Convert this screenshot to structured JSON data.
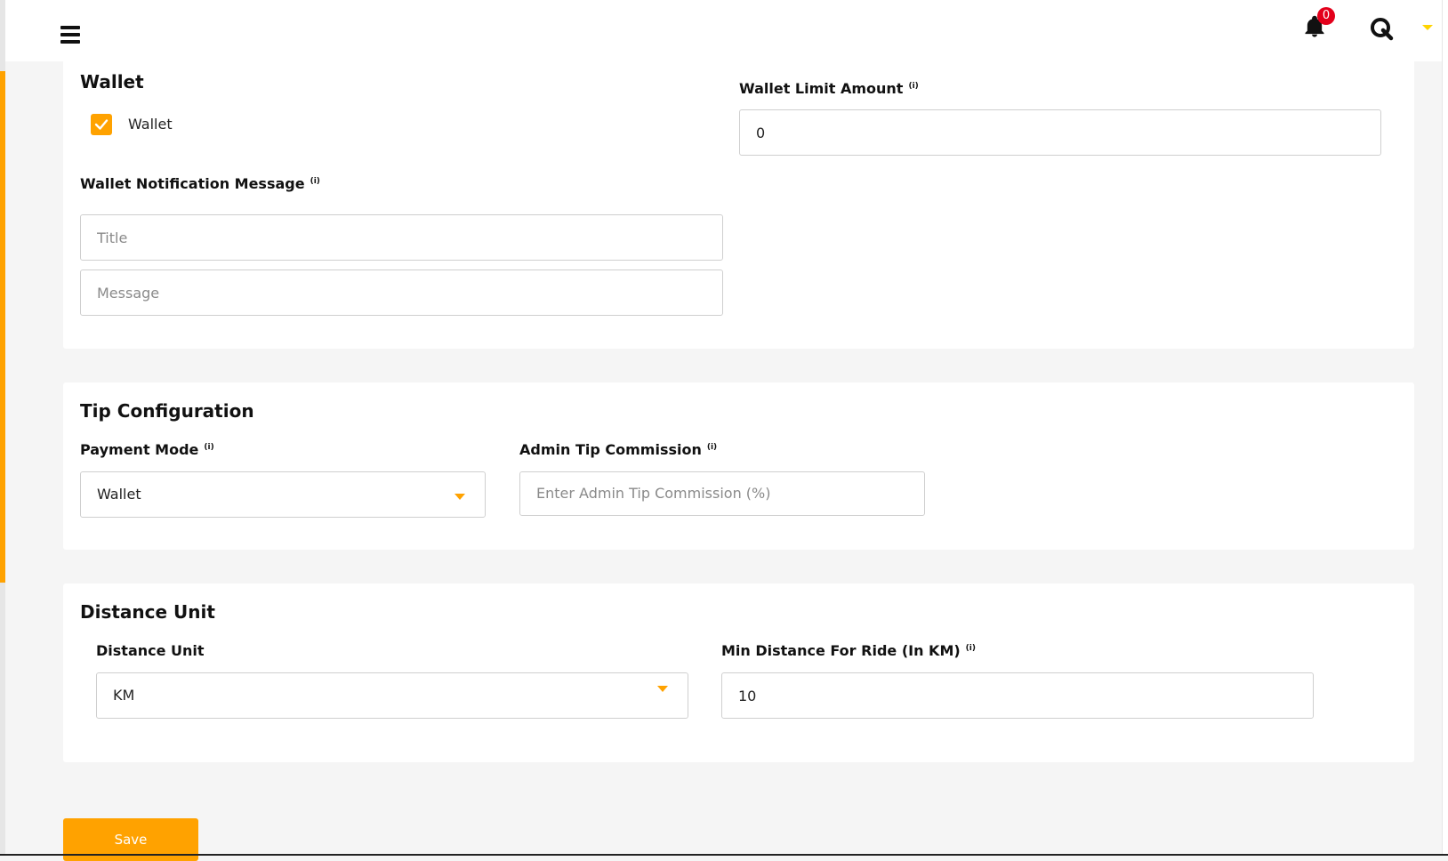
{
  "header": {
    "menu_icon": "hamburger-icon",
    "notification_icon": "bell-icon",
    "notification_count": "0",
    "avatar_icon": "q-logo-icon",
    "dropdown_icon": "caret-down-icon",
    "accent_color": "#ffa200"
  },
  "wallet": {
    "title": "Wallet",
    "checkbox_label": "Wallet",
    "checkbox_checked": true,
    "limit_label": "Wallet Limit Amount",
    "limit_value": "0",
    "notification_label": "Wallet Notification Message",
    "title_placeholder": "Title",
    "message_placeholder": "Message"
  },
  "tip": {
    "title": "Tip Configuration",
    "payment_mode_label": "Payment Mode",
    "payment_mode_value": "Wallet",
    "commission_label": "Admin Tip Commission",
    "commission_placeholder": "Enter Admin Tip Commission (%)"
  },
  "distance": {
    "title": "Distance Unit",
    "unit_label": "Distance Unit",
    "unit_value": "KM",
    "min_label": "Min Distance For Ride (In KM)",
    "min_value": "10"
  },
  "info_icon_text": "(i)",
  "save_label": "Save"
}
